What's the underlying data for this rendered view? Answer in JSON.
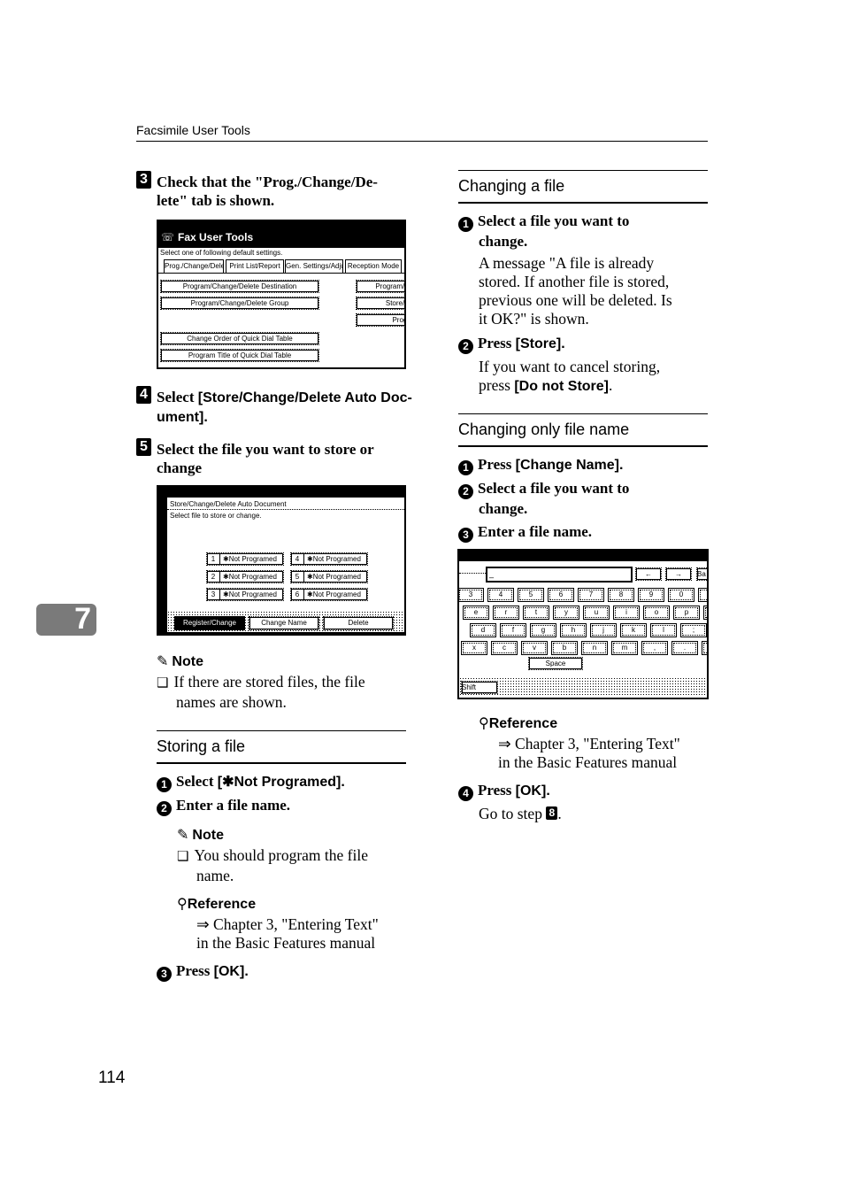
{
  "header": {
    "running_title": "Facsimile User Tools",
    "page_number": "114",
    "chapter_tab": "7"
  },
  "left": {
    "step3": {
      "num": "3",
      "text_line1": "Check that the \"Prog./Change/De-",
      "text_line2": "lete\" tab is shown."
    },
    "screen1": {
      "title": "Fax User Tools",
      "instruction": "Select one of following default settings.",
      "tabs": [
        "Prog./Change/Delete",
        "Print List/Report",
        "Gen. Settings/Adjust",
        "Reception Mode"
      ],
      "left_buttons": [
        "Program/Change/Delete Destination",
        "Program/Change/Delete Group",
        "Change Order of Quick Dial Table",
        "Program Title of Quick Dial Table"
      ],
      "right_buttons": [
        "Program/C",
        "Store/C",
        "Progr"
      ]
    },
    "step4": {
      "num": "4",
      "prefix": "Select ",
      "bracket_line1": "[Store/Change/Delete Auto Doc-",
      "bracket_line2": "ument]."
    },
    "step5": {
      "num": "5",
      "text_line1": "Select the file you want to store or",
      "text_line2": "change"
    },
    "screen2": {
      "title": "Store/Change/Delete Auto Document",
      "instruction": "Select file to store or change.",
      "files": [
        {
          "num": "1",
          "label": "✱Not Programed"
        },
        {
          "num": "2",
          "label": "✱Not Programed"
        },
        {
          "num": "3",
          "label": "✱Not Programed"
        },
        {
          "num": "4",
          "label": "✱Not Programed"
        },
        {
          "num": "5",
          "label": "✱Not Programed"
        },
        {
          "num": "6",
          "label": "✱Not Programed"
        }
      ],
      "bottom_buttons": [
        "Register/Change",
        "Change Name",
        "Delete"
      ]
    },
    "note1": {
      "heading": "Note",
      "line1": "If there are stored files, the file",
      "line2": "names are shown."
    },
    "storing": {
      "title": "Storing a file",
      "s1_prefix": "Select ",
      "s1_bracket": "[✱Not Programed].",
      "s2": "Enter a file name.",
      "note": {
        "heading": "Note",
        "line1": "You should program the file",
        "line2": "name."
      },
      "reference": {
        "heading": "Reference",
        "line1": "⇒ Chapter 3, \"Entering Text\"",
        "line2": "in the Basic Features manual"
      },
      "s3_prefix": "Press ",
      "s3_bracket": "[OK]."
    }
  },
  "right": {
    "changing": {
      "title": "Changing a file",
      "s1_line1": "Select a file you want to",
      "s1_line2": "change.",
      "msg_lines": [
        "A message \"A file is already",
        "stored. If another file is stored,",
        "previous one will be deleted. Is",
        "it OK?\" is shown."
      ],
      "s2_prefix": "Press ",
      "s2_bracket": "[Store].",
      "cancel_line1": "If you want to cancel storing,",
      "cancel_prefix": "press ",
      "cancel_bracket": "[Do not Store]",
      "cancel_suffix": "."
    },
    "changing_name": {
      "title": "Changing only file name",
      "s1_prefix": "Press ",
      "s1_bracket": "[Change Name].",
      "s2_line1": "Select a file you want to",
      "s2_line2": "change.",
      "s3": "Enter a file name."
    },
    "keyboard": {
      "arrow_left": "←",
      "arrow_right": "→",
      "back": "Ba",
      "row1": [
        "3",
        "4",
        "5",
        "6",
        "7",
        "8",
        "9",
        "0",
        "-"
      ],
      "row2": [
        "e",
        "r",
        "t",
        "y",
        "u",
        "i",
        "o",
        "p",
        ""
      ],
      "row3": [
        "d",
        "f",
        "g",
        "h",
        "j",
        "k",
        "l",
        ";",
        ""
      ],
      "row4": [
        "x",
        "c",
        "v",
        "b",
        "n",
        "m",
        ",",
        ".",
        "/"
      ],
      "space": "Space",
      "shift": "Shift"
    },
    "reference": {
      "heading": "Reference",
      "line1": "⇒ Chapter 3, \"Entering Text\"",
      "line2": "in the Basic Features manual"
    },
    "s4_prefix": "Press ",
    "s4_bracket": "[OK].",
    "goto_text": "Go to step ",
    "goto_step": "8",
    "goto_suffix": "."
  },
  "step_numbers": [
    "1",
    "2",
    "3",
    "4"
  ]
}
